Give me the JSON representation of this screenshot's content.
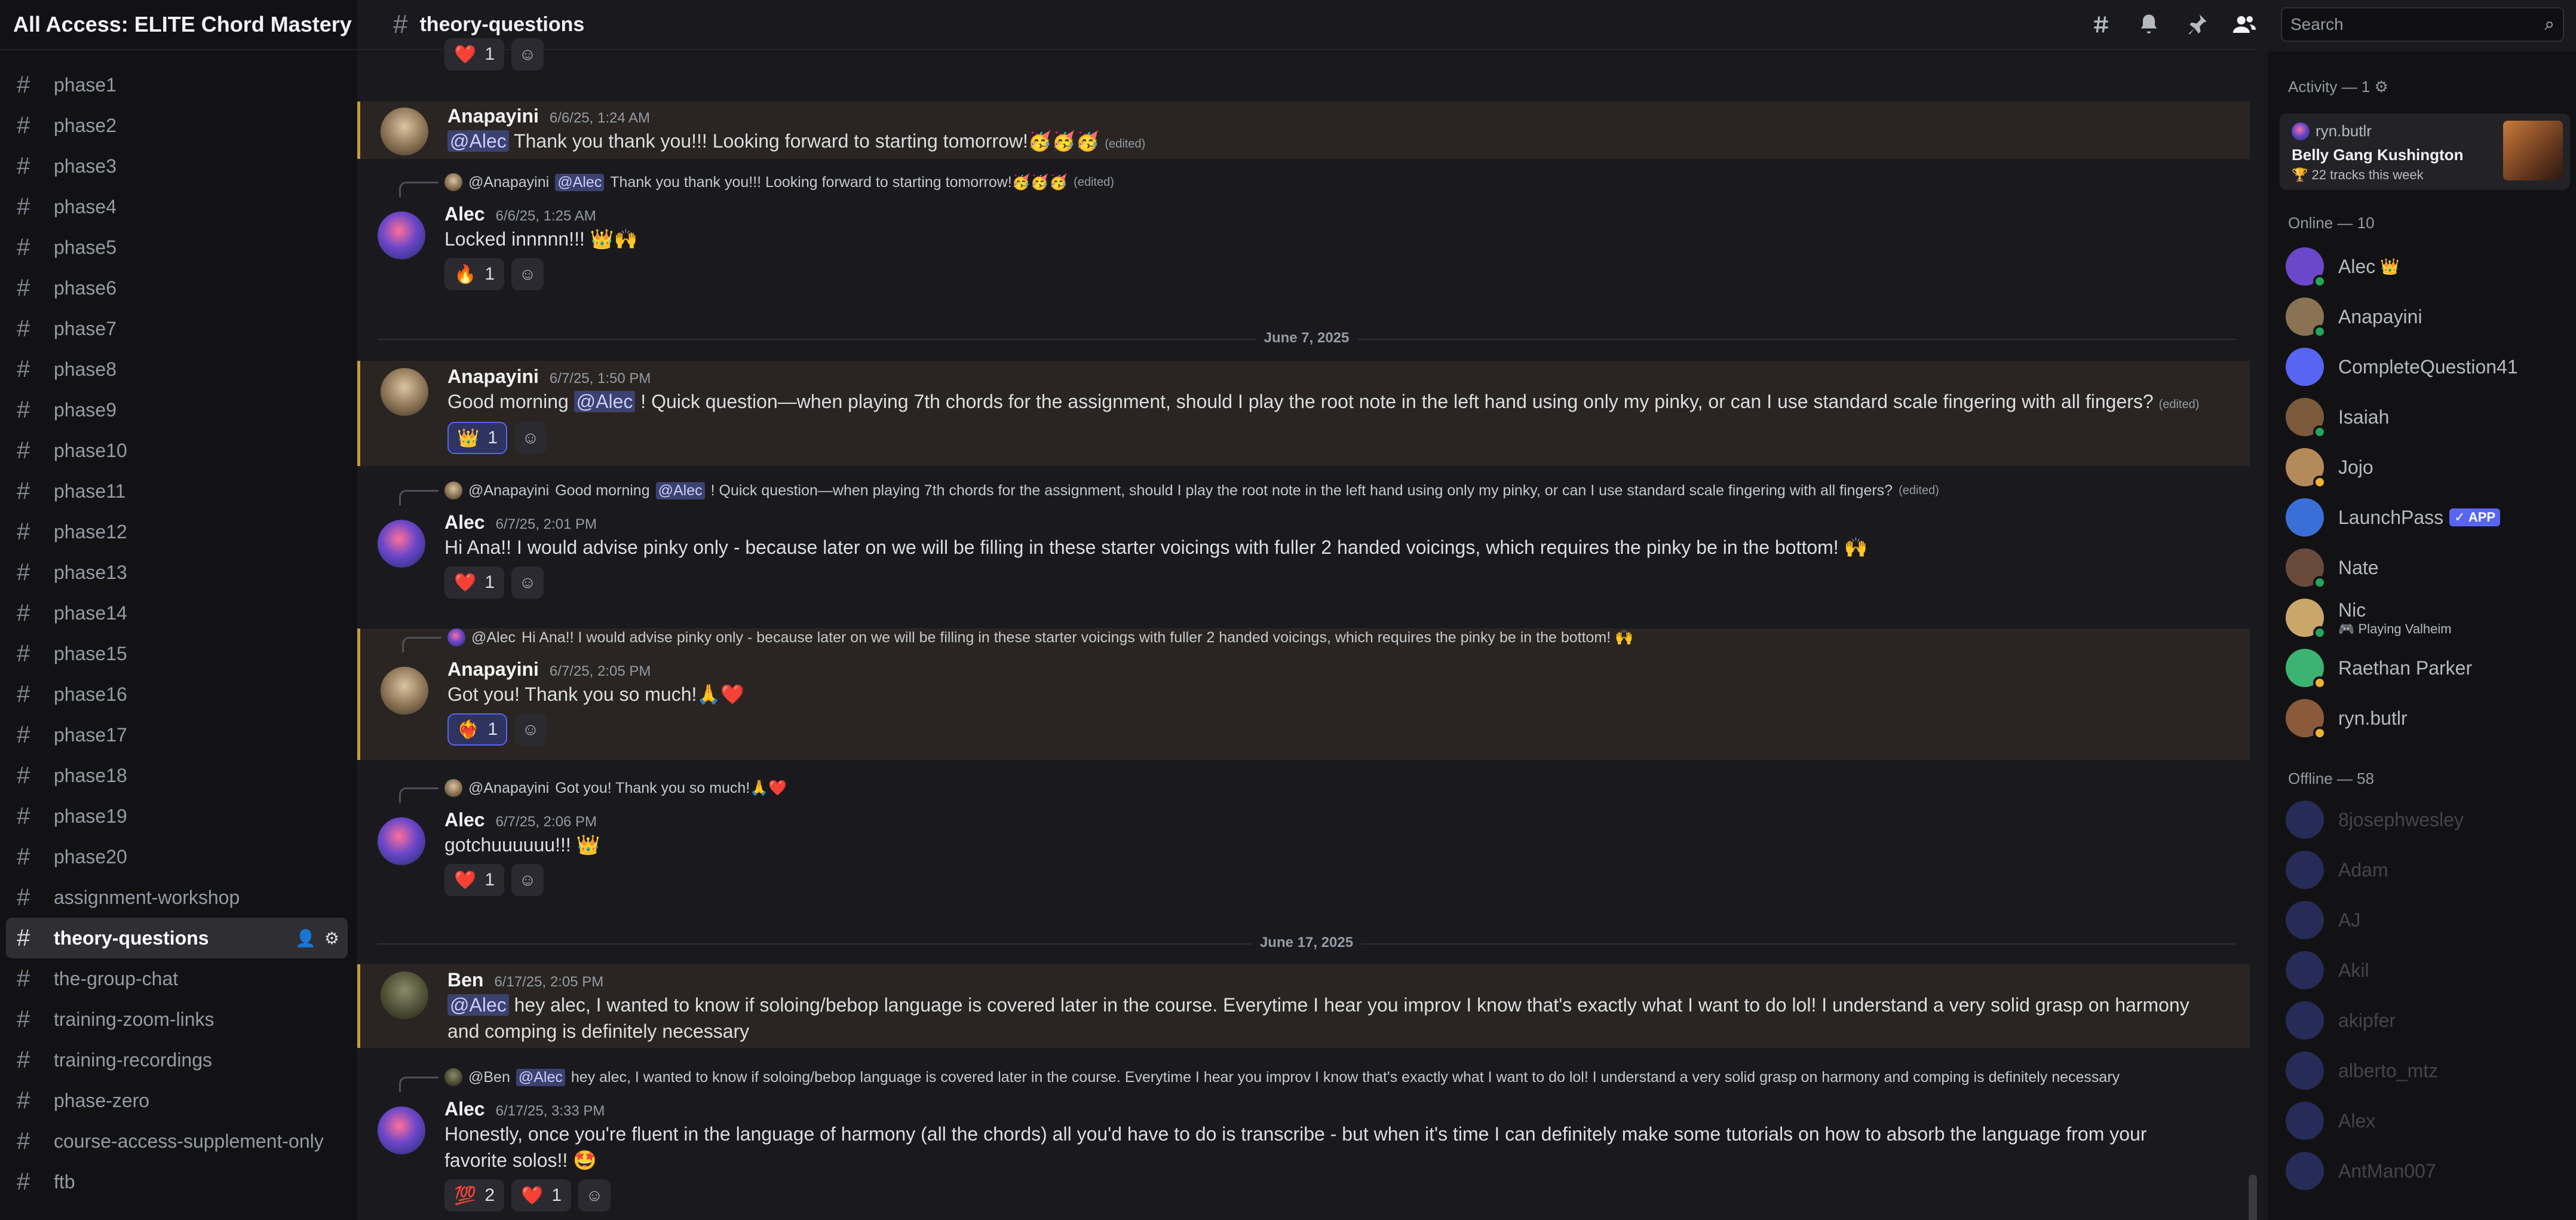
{
  "server": {
    "name": "All Access: ELITE Chord Mastery B...",
    "chevron_icon": "chevron-down-icon"
  },
  "channels": [
    "phase1",
    "phase2",
    "phase3",
    "phase4",
    "phase5",
    "phase6",
    "phase7",
    "phase8",
    "phase9",
    "phase10",
    "phase11",
    "phase12",
    "phase13",
    "phase14",
    "phase15",
    "phase16",
    "phase17",
    "phase18",
    "phase19",
    "phase20",
    "assignment-workshop",
    "theory-questions",
    "the-group-chat",
    "training-zoom-links",
    "training-recordings",
    "phase-zero",
    "course-access-supplement-only",
    "ftb"
  ],
  "active_channel": "theory-questions",
  "chat": {
    "title": "theory-questions",
    "messages": {
      "m1": {
        "author": "Anapayini",
        "time": "6/6/25, 1:24 AM",
        "mention": "@Alec",
        "text": "Thank you thank you!!! Looking forward to starting tomorrow!🥳🥳🥳",
        "edited": "(edited)"
      },
      "m2": {
        "reply_author": "@Anapayini",
        "reply_mention": "@Alec",
        "reply_text": "Thank you thank you!!! Looking forward to starting tomorrow!🥳🥳🥳",
        "reply_edited": "(edited)",
        "author": "Alec",
        "time": "6/6/25, 1:25 AM",
        "text": "Locked innnnn!!! 👑🙌",
        "reactions": [
          {
            "emoji": "🔥",
            "count": "1"
          }
        ]
      },
      "divider1": "June 7, 2025",
      "m3": {
        "author": "Anapayini",
        "time": "6/7/25, 1:50 PM",
        "text_before": "Good morning",
        "mention": "@Alec",
        "text_after": "! Quick question—when playing 7th chords for the assignment, should I play the root note in the left hand using only my pinky, or can I use standard scale fingering with all fingers?",
        "edited": "(edited)",
        "reactions": [
          {
            "emoji": "👑",
            "count": "1"
          }
        ]
      },
      "m4": {
        "reply_author": "@Anapayini",
        "reply_before": "Good morning",
        "reply_mention": "@Alec",
        "reply_after": "! Quick question—when playing 7th chords for the assignment, should I play the root note in the left hand using only my pinky, or can I use standard scale fingering with all fingers?",
        "reply_edited": "(edited)",
        "author": "Alec",
        "time": "6/7/25, 2:01 PM",
        "text": "Hi Ana!! I would advise pinky only - because later on we will be filling in these starter voicings with fuller 2 handed voicings, which requires the pinky be in the bottom! 🙌",
        "reactions": [
          {
            "emoji": "❤️",
            "count": "1"
          }
        ]
      },
      "m5": {
        "reply_author": "@Alec",
        "reply_text": "Hi Ana!! I would advise pinky only - because later on we will be filling in these starter voicings with fuller 2 handed voicings, which requires the pinky be in the bottom! 🙌",
        "author": "Anapayini",
        "time": "6/7/25, 2:05 PM",
        "text": "Got you! Thank you so much!🙏❤️",
        "reactions": [
          {
            "emoji": "❤️‍🔥",
            "count": "1"
          }
        ]
      },
      "m6": {
        "reply_author": "@Anapayini",
        "reply_text": "Got you! Thank you so much!🙏❤️",
        "author": "Alec",
        "time": "6/7/25, 2:06 PM",
        "text": "gotchuuuuuu!!! 👑",
        "reactions": [
          {
            "emoji": "❤️",
            "count": "1"
          }
        ]
      },
      "divider2": "June 17, 2025",
      "m7": {
        "author": "Ben",
        "time": "6/17/25, 2:05 PM",
        "mention": "@Alec",
        "text": "hey alec, I wanted to know if soloing/bebop language is covered later in the course. Everytime I hear you improv I know that's exactly what I want to do lol! I understand a very solid grasp on harmony and comping is definitely necessary"
      },
      "m8": {
        "reply_author": "@Ben",
        "reply_mention": "@Alec",
        "reply_text": "hey alec, I wanted to know if soloing/bebop language is covered later in the course. Everytime I hear you improv I know that's exactly what I want to do lol! I understand a very solid grasp on harmony and comping is definitely necessary",
        "author": "Alec",
        "time": "6/17/25, 3:33 PM",
        "text": "Honestly, once you're fluent in the language of harmony (all the chords) all you'd have to do is transcribe - but when it's time I can definitely make some tutorials on how to absorb the language from your favorite solos!! 🤩",
        "reactions": [
          {
            "emoji": "💯",
            "count": "2"
          },
          {
            "emoji": "❤️",
            "count": "1"
          }
        ]
      },
      "top_partial_reaction": {
        "emoji": "❤️",
        "count": "1"
      }
    }
  },
  "search": {
    "placeholder": "Search"
  },
  "header_icons": [
    "threads-icon",
    "bell-icon",
    "pin-icon",
    "members-icon"
  ],
  "members": {
    "activity_title": "Activity — 1",
    "activity": {
      "user": "ryn.butlr",
      "title": "Belly Gang Kushington",
      "subtitle": "🏆 22 tracks this week"
    },
    "online_title": "Online — 10",
    "online": [
      {
        "name": "Alec",
        "status": "online",
        "crown": "👑"
      },
      {
        "name": "Anapayini",
        "status": "online"
      },
      {
        "name": "CompleteQuestion41",
        "status": "none"
      },
      {
        "name": "Isaiah",
        "status": "online"
      },
      {
        "name": "Jojo",
        "status": "idle"
      },
      {
        "name": "LaunchPass",
        "status": "none",
        "badge": "✓ APP"
      },
      {
        "name": "Nate",
        "status": "online"
      },
      {
        "name": "Nic",
        "status": "online",
        "sub": "🎮 Playing Valheim"
      },
      {
        "name": "Raethan Parker",
        "status": "idle"
      },
      {
        "name": "ryn.butlr",
        "status": "idle"
      }
    ],
    "offline_title": "Offline — 58",
    "offline": [
      "8josephwesley",
      "Adam",
      "AJ",
      "Akil",
      "akipfer",
      "alberto_mtz",
      "Alex",
      "AntMan007"
    ]
  },
  "colors": {
    "accent": "#5865f2",
    "highlight_border": "#c99a3e",
    "online": "#23a55a",
    "idle": "#f0b232"
  }
}
